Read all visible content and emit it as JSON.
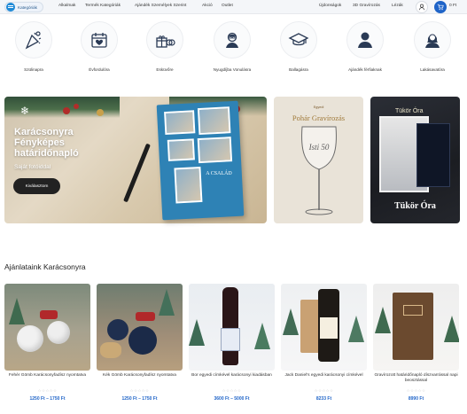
{
  "header": {
    "menu_label": "Kategóriák",
    "nav": [
      "Alkalmak",
      "Termék Kategóriák",
      "Ajándék Személyek Szerint",
      "Akció",
      "Outlet"
    ],
    "right_links": [
      "Újdonságok",
      "3D Gravírozás",
      "Lézák"
    ],
    "cart_total": "0 Ft",
    "icons": [
      "menu-icon",
      "user-icon",
      "cart-icon"
    ]
  },
  "occasions": [
    {
      "label": "Szülinapra",
      "icon": "party-icon"
    },
    {
      "label": "Évfordulóra",
      "icon": "calendar-heart-icon"
    },
    {
      "label": "Esküvőre",
      "icon": "gift-rings-icon"
    },
    {
      "label": "Nyugdíjba Vonulásra",
      "icon": "retiree-icon"
    },
    {
      "label": "Ballagásra",
      "icon": "graduation-cap-icon"
    },
    {
      "label": "Ajándék férfiaknak",
      "icon": "man-icon"
    },
    {
      "label": "Lakásavatóra",
      "icon": "woman-icon"
    }
  ],
  "banners": {
    "main": {
      "title": "Karácsonyra Fényképes határidőnapló",
      "subtitle": "Saját fotóiddal",
      "button": "Kiválasztom",
      "book_label": "A CSALÁD"
    },
    "middle": {
      "small": "Egyedi",
      "title": "Pohár Gravírozás",
      "glass_text": "Isti 50"
    },
    "right": {
      "top": "Tükör Óra",
      "bottom": "Tükör Óra"
    }
  },
  "section": {
    "title": "Ajánlataink Karácsonyra"
  },
  "products": [
    {
      "name": "Fehér Gömb Karácsonyfadísz nyomtatva",
      "price": "1250 Ft – 1750 Ft",
      "stars": "☆☆☆☆☆"
    },
    {
      "name": "Kék Gömb Karácsonyfadísz nyomtatva",
      "price": "1250 Ft – 1750 Ft",
      "stars": "☆☆☆☆☆"
    },
    {
      "name": "Bor egyedi címkével karácsonyi kiadásban",
      "price": "3600 Ft – 5000 Ft",
      "stars": "☆☆☆☆☆"
    },
    {
      "name": "Jack Daniel's egyedi karácsonyi címkével",
      "price": "8233 Ft",
      "stars": "☆☆☆☆☆"
    },
    {
      "name": "Gravírozott határidőnapló díszvarrással napi beosztással",
      "price": "8990 Ft",
      "stars": "☆☆☆☆☆"
    }
  ],
  "colors": {
    "accent": "#1f64c8",
    "price": "#1f64c8",
    "dark_button": "#222222"
  }
}
